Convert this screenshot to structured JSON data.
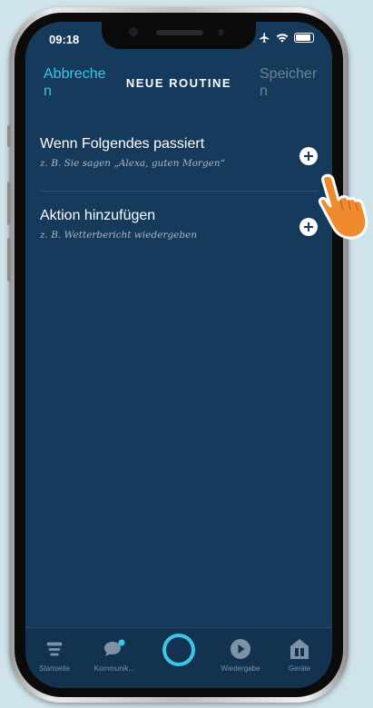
{
  "status_bar": {
    "time": "09:18",
    "icons": [
      "airplane-icon",
      "wifi-icon",
      "battery-icon"
    ]
  },
  "header": {
    "cancel_label": "Abbrechen",
    "title": "NEUE ROUTINE",
    "save_label": "Speichern"
  },
  "rows": [
    {
      "title": "Wenn Folgendes passiert",
      "subtitle": "z. B. Sie sagen „Alexa, guten Morgen“"
    },
    {
      "title": "Aktion hinzufügen",
      "subtitle": "z. B. Wetterbericht wiedergeben"
    }
  ],
  "bottom_nav": {
    "items": [
      {
        "label": "Startseite",
        "icon": "home-icon"
      },
      {
        "label": "Kommunik...",
        "icon": "chat-icon"
      },
      {
        "label": "",
        "icon": "alexa-icon"
      },
      {
        "label": "Wiedergabe",
        "icon": "play-icon"
      },
      {
        "label": "Geräte",
        "icon": "devices-icon"
      }
    ]
  },
  "colors": {
    "background": "#163a5c",
    "accent": "#3bc7e6",
    "disabled": "#6c8396",
    "pointer": "#f08a2e"
  }
}
